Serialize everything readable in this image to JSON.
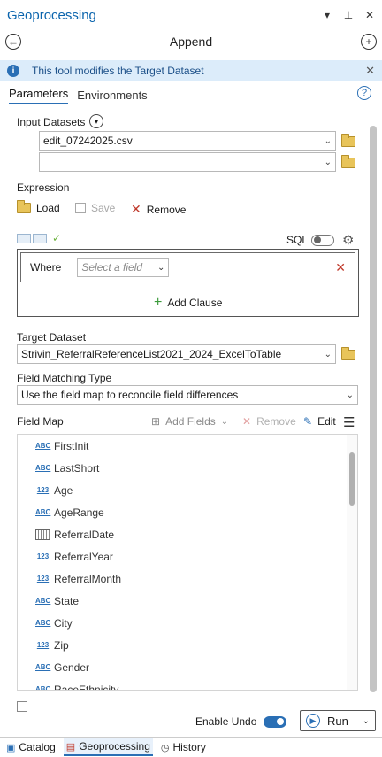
{
  "window": {
    "title": "Geoprocessing",
    "controls": [
      "▾",
      "📌",
      "✕"
    ]
  },
  "tool": {
    "name": "Append"
  },
  "info_banner": {
    "text": "This tool modifies the Target Dataset"
  },
  "tabs": [
    {
      "label": "Parameters",
      "active": true
    },
    {
      "label": "Environments",
      "active": false
    }
  ],
  "input_datasets": {
    "label": "Input Datasets",
    "values": [
      "edit_07242025.csv",
      ""
    ]
  },
  "expression": {
    "label": "Expression",
    "load_label": "Load",
    "save_label": "Save",
    "remove_label": "Remove",
    "sql_label": "SQL",
    "where_label": "Where",
    "field_placeholder": "Select a field",
    "add_clause_label": "Add Clause"
  },
  "target_dataset": {
    "label": "Target Dataset",
    "value": "Strivin_ReferralReferenceList2021_2024_ExcelToTable"
  },
  "field_matching": {
    "label": "Field Matching Type",
    "value": "Use the field map to reconcile field differences"
  },
  "field_map": {
    "label": "Field Map",
    "add_fields_label": "Add Fields",
    "remove_label": "Remove",
    "edit_label": "Edit",
    "fields": [
      {
        "type": "ABC",
        "name": "FirstInit"
      },
      {
        "type": "ABC",
        "name": "LastShort"
      },
      {
        "type": "123",
        "name": "Age"
      },
      {
        "type": "ABC",
        "name": "AgeRange"
      },
      {
        "type": "date",
        "name": "ReferralDate"
      },
      {
        "type": "123",
        "name": "ReferralYear"
      },
      {
        "type": "123",
        "name": "ReferralMonth"
      },
      {
        "type": "ABC",
        "name": "State"
      },
      {
        "type": "ABC",
        "name": "City"
      },
      {
        "type": "123",
        "name": "Zip"
      },
      {
        "type": "ABC",
        "name": "Gender"
      },
      {
        "type": "ABC",
        "name": "RaceEthnicity"
      }
    ]
  },
  "footer": {
    "enable_undo_label": "Enable Undo",
    "run_label": "Run"
  },
  "bottom_tabs": [
    {
      "label": "Catalog",
      "active": false
    },
    {
      "label": "Geoprocessing",
      "active": true
    },
    {
      "label": "History",
      "active": false
    }
  ]
}
